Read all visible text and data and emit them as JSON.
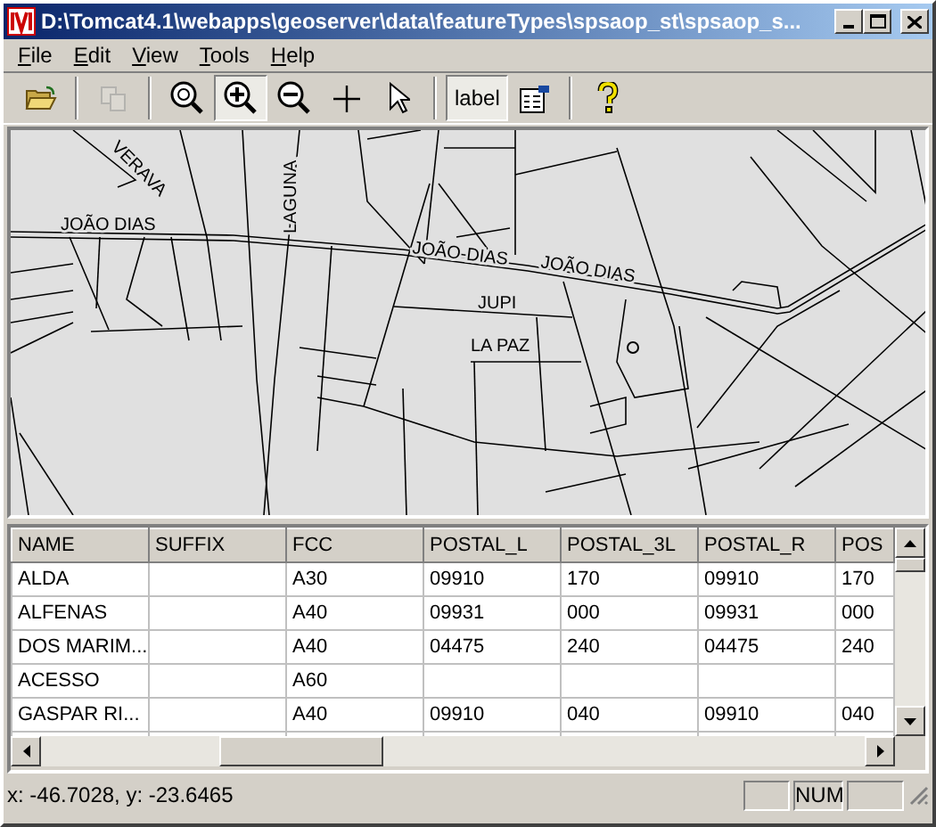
{
  "window": {
    "title": "D:\\Tomcat4.1\\webapps\\geoserver\\data\\featureTypes\\spsaop_st\\spsaop_s..."
  },
  "menu": [
    "File",
    "Edit",
    "View",
    "Tools",
    "Help"
  ],
  "toolbar": [
    {
      "kind": "open",
      "pressed": false,
      "disabled": false
    },
    {
      "kind": "separator"
    },
    {
      "kind": "copy",
      "pressed": false,
      "disabled": true
    },
    {
      "kind": "separator"
    },
    {
      "kind": "zoom-extent",
      "pressed": false,
      "disabled": false
    },
    {
      "kind": "zoom-in",
      "pressed": true,
      "disabled": false
    },
    {
      "kind": "zoom-out",
      "pressed": false,
      "disabled": false
    },
    {
      "kind": "crosshair",
      "pressed": false,
      "disabled": false
    },
    {
      "kind": "pointer",
      "pressed": false,
      "disabled": false
    },
    {
      "kind": "separator"
    },
    {
      "kind": "label",
      "label": "label",
      "pressed": true,
      "disabled": false
    },
    {
      "kind": "properties",
      "pressed": false,
      "disabled": false
    },
    {
      "kind": "separator"
    },
    {
      "kind": "help",
      "pressed": false,
      "disabled": false
    }
  ],
  "map": {
    "labels": [
      {
        "text": "VERAVA"
      },
      {
        "text": "JOÃO DIAS"
      },
      {
        "text": "LAGUNA"
      },
      {
        "text": "JOÃO-DIAS"
      },
      {
        "text": "JOÃO DIAS"
      },
      {
        "text": "JUPI"
      },
      {
        "text": "LA PAZ"
      }
    ]
  },
  "table": {
    "columns": [
      "NAME",
      "SUFFIX",
      "FCC",
      "POSTAL_L",
      "POSTAL_3L",
      "POSTAL_R",
      "POS"
    ],
    "rows": [
      [
        "ALDA",
        null,
        "A30",
        "09910",
        "170",
        "09910",
        "170"
      ],
      [
        "ALFENAS",
        null,
        "A40",
        "09931",
        "000",
        "09931",
        "000"
      ],
      [
        "DOS MARIM...",
        null,
        "A40",
        "04475",
        "240",
        "04475",
        "240"
      ],
      [
        "ACESSO",
        null,
        "A60",
        null,
        null,
        null,
        null
      ],
      [
        "GASPAR RI...",
        null,
        "A40",
        "09910",
        "040",
        "09910",
        "040"
      ]
    ]
  },
  "status_bar": {
    "coordinates": "x: -46.7028, y: -23.6465",
    "indicator": "NUM"
  }
}
